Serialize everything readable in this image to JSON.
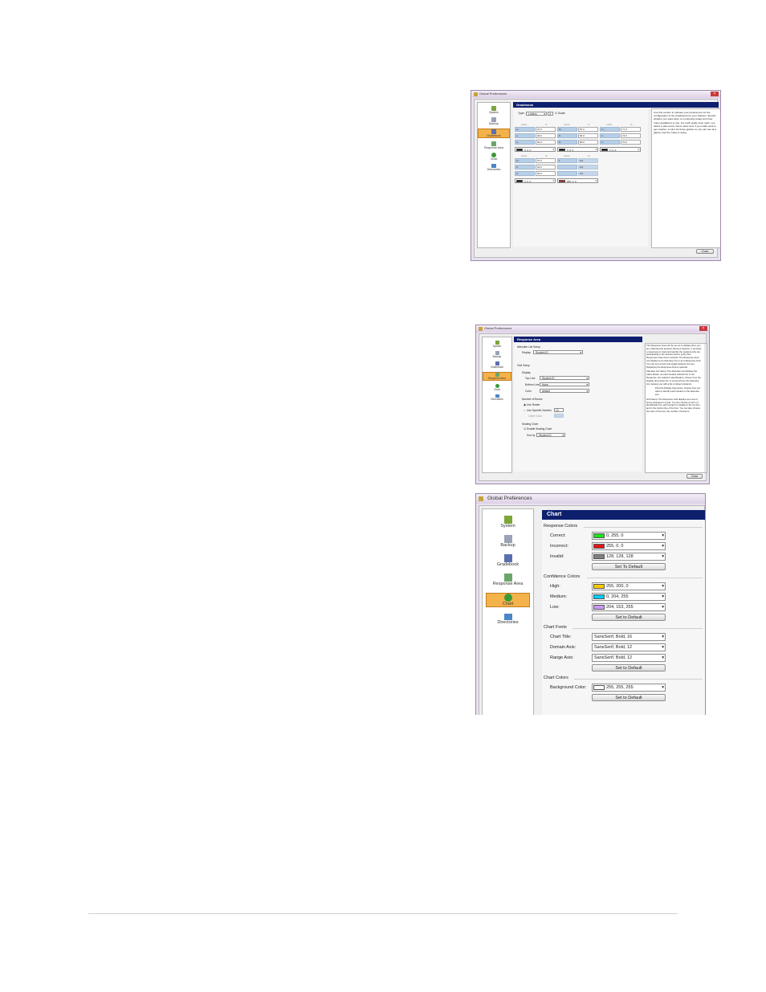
{
  "window_title": "Global Preferences",
  "nav": {
    "system": "System",
    "backup": "Backup",
    "gradebook": "Gradebook",
    "response_area": "Response Area",
    "chart": "Chart",
    "directories": "Directories"
  },
  "close_label": "Close",
  "gradebook": {
    "header": "Gradebook",
    "type_label": "Type:",
    "type_value": "Letters",
    "type_number": "3",
    "scale_label": "Scale",
    "col_label": "Label",
    "col_pct": "%",
    "groups": [
      {
        "labels": [
          "A+",
          "A",
          "A-"
        ],
        "pcts": [
          "97.0",
          "94.0",
          "90.0"
        ],
        "color": "0, 0, 0"
      },
      {
        "labels": [
          "B+",
          "B",
          "B-"
        ],
        "pcts": [
          "87.0",
          "84.0",
          "80.0"
        ],
        "color": "0, 0, 0"
      },
      {
        "labels": [
          "C+",
          "C",
          "C-"
        ],
        "pcts": [
          "77.0",
          "74.0",
          "70.0"
        ],
        "color": "0, 0, 0"
      },
      {
        "labels": [
          "D+",
          "D",
          "D-"
        ],
        "pcts": [
          "67.0",
          "64.0",
          "60.0"
        ],
        "color": "0, 0, 0"
      },
      {
        "labels": [
          "F",
          "",
          ""
        ],
        "pcts": [
          "0.0",
          "0.0",
          "0.0"
        ],
        "color": "255, 0, 0"
      }
    ],
    "help": "Use this section to indicate your preferences for the configuration of the Gradebook for your Classes. Specify whether you want letter or numbering scales and how many gradations to use. For each grade level mark, you define a plus and a minus value and, if you really want to get creative, a color for those grades so you can see at a glance how the Class is doing."
  },
  "response_area": {
    "header": "Response Area",
    "attendee_setup": "Attendee List Setup",
    "display_label": "Display",
    "display_value": "Student ID",
    "grid_setup": "Grid Setup",
    "display_sub": "Display",
    "top_line_label": "Top Line",
    "top_line_value": "Student ID",
    "bottom_line_label": "Bottom Line",
    "bottom_line_value": "None",
    "color_label": "Color",
    "color_value": "default",
    "rows_label": "Number of Boxes",
    "use_roster": "Use Roster",
    "use_specific": "Use Specific Number",
    "specific_value": "10",
    "label_text_label": "Label Color",
    "seating_label": "Seating Chart",
    "enable_seating": "Enable Seating Chart",
    "sort_label": "Sort by",
    "sort_value": "Student ID",
    "help": "The Response Area can be set up to display when you are collecting the answers during a Session. It provides a visual way to track and identify the students who are participating in the Session and to verify their Responses have been received. The Response Area can display as an Attendee List or as a Response Grid. You can set up both and toggle between the two. Displaying the Response Area is optional.",
    "help2": "Attendee List Setup: The Attendee List displays the Class Roster. As each student submits his or her Response, the student's identification, chosen from the Display drop-down list, is removed from the Attendee List, leaving you with a list of absent students.",
    "help3": "Print the Display drop-down, choose how you want to identify each student in the Attendee List.",
    "help4": "Grid Setup: The Response Grid displays as a set of boxes arranged in a grid. You can choose an item of identification for each student to display in the top line and in the bottom line of the box. You can also choose the color of the box, the number of boxes in"
  },
  "chart": {
    "header": "Chart",
    "response_colors": "Response Colors",
    "correct_label": "Correct:",
    "correct_value": "0, 255, 0",
    "correct_color": "#1ee11e",
    "incorrect_label": "Incorrect:",
    "incorrect_value": "255, 0, 0",
    "incorrect_color": "#e01818",
    "invalid_label": "Invalid:",
    "invalid_value": "128, 128, 128",
    "invalid_color": "#808080",
    "set_to_default_1": "Set To Default",
    "confidence_colors": "Confidence Colors",
    "high_label": "High:",
    "high_value": "255, 200, 0",
    "high_color": "#ffc800",
    "medium_label": "Medium:",
    "medium_value": "0, 204, 255",
    "medium_color": "#00ccff",
    "low_label": "Low:",
    "low_value": "204, 153, 255",
    "low_color": "#cc99ff",
    "set_to_default_2": "Set to Default",
    "chart_fonts": "Chart Fonts",
    "chart_title_label": "Chart Title:",
    "chart_title_value": "SansSerif, Bold, 16",
    "domain_axis_label": "Domain Axis:",
    "domain_axis_value": "SansSerif, Bold, 12",
    "range_axis_label": "Range Axis:",
    "range_axis_value": "SansSerif, Bold, 12",
    "set_to_default_3": "Set to Default",
    "chart_colors": "Chart Colors",
    "background_label": "Background Color:",
    "background_value": "255, 255, 255",
    "background_color": "#ffffff",
    "set_to_default_4": "Set to Default"
  }
}
